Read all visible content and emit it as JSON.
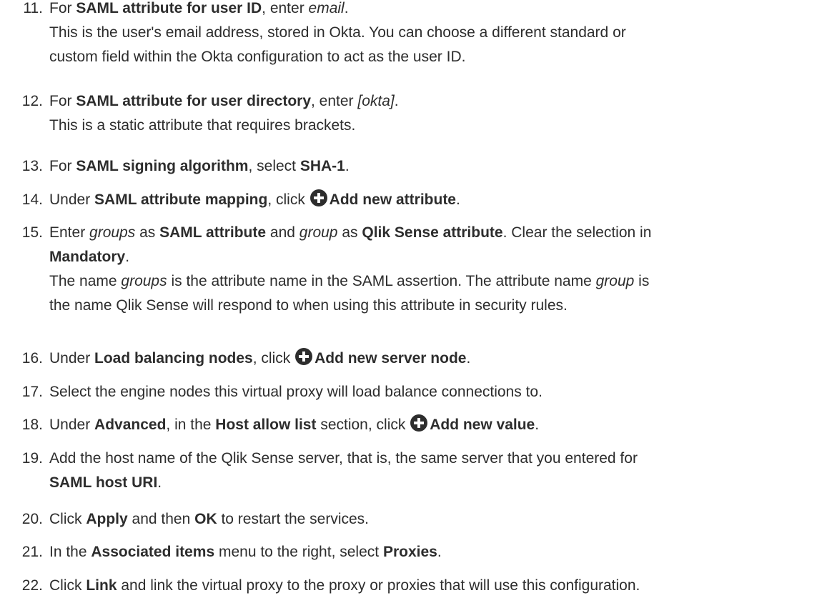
{
  "steps": [
    {
      "number": "11.",
      "lines": [
        [
          {
            "t": "For "
          },
          {
            "t": "SAML attribute for user ID",
            "b": true
          },
          {
            "t": ", enter "
          },
          {
            "t": "email",
            "i": true
          },
          {
            "t": "."
          }
        ],
        [
          {
            "t": "This is the user's email address, stored in Okta. You can choose a different standard or"
          }
        ],
        [
          {
            "t": "custom field within the Okta configuration to act as the user ID."
          }
        ]
      ]
    },
    {
      "number": "12.",
      "lines": [
        [
          {
            "t": "For "
          },
          {
            "t": "SAML attribute for user directory",
            "b": true
          },
          {
            "t": ", enter "
          },
          {
            "t": "[okta]",
            "i": true
          },
          {
            "t": "."
          }
        ],
        [
          {
            "t": "This is a static attribute that requires brackets."
          }
        ]
      ]
    },
    {
      "number": "13.",
      "lines": [
        [
          {
            "t": "For "
          },
          {
            "t": "SAML signing algorithm",
            "b": true
          },
          {
            "t": ", select "
          },
          {
            "t": "SHA-1",
            "b": true
          },
          {
            "t": "."
          }
        ]
      ]
    },
    {
      "number": "14.",
      "lines": [
        [
          {
            "t": "Under "
          },
          {
            "t": "SAML attribute mapping",
            "b": true
          },
          {
            "t": ", click "
          },
          {
            "icon": "plus-circle-icon"
          },
          {
            "t": "Add new attribute",
            "b": true
          },
          {
            "t": "."
          }
        ]
      ]
    },
    {
      "number": "15.",
      "lines": [
        [
          {
            "t": "Enter "
          },
          {
            "t": "groups",
            "i": true
          },
          {
            "t": " as "
          },
          {
            "t": "SAML attribute",
            "b": true
          },
          {
            "t": " and "
          },
          {
            "t": "group",
            "i": true
          },
          {
            "t": " as "
          },
          {
            "t": "Qlik Sense attribute",
            "b": true
          },
          {
            "t": ". Clear the selection in"
          }
        ],
        [
          {
            "t": "Mandatory",
            "b": true
          },
          {
            "t": "."
          }
        ],
        [
          {
            "t": "The name "
          },
          {
            "t": "groups",
            "i": true
          },
          {
            "t": " is the attribute name in the SAML assertion. The attribute name "
          },
          {
            "t": "group",
            "i": true
          },
          {
            "t": " is"
          }
        ],
        [
          {
            "t": "the name Qlik Sense will respond to when using this attribute in security rules."
          }
        ]
      ]
    },
    {
      "number": "16.",
      "lines": [
        [
          {
            "t": "Under "
          },
          {
            "t": "Load balancing nodes",
            "b": true
          },
          {
            "t": ", click "
          },
          {
            "icon": "plus-circle-icon"
          },
          {
            "t": "Add new server node",
            "b": true
          },
          {
            "t": "."
          }
        ]
      ]
    },
    {
      "number": "17.",
      "lines": [
        [
          {
            "t": "Select the engine nodes this virtual proxy will load balance connections to."
          }
        ]
      ]
    },
    {
      "number": "18.",
      "lines": [
        [
          {
            "t": "Under "
          },
          {
            "t": "Advanced",
            "b": true
          },
          {
            "t": ", in the "
          },
          {
            "t": "Host allow list",
            "b": true
          },
          {
            "t": " section, click "
          },
          {
            "icon": "plus-circle-icon"
          },
          {
            "t": "Add new value",
            "b": true
          },
          {
            "t": "."
          }
        ]
      ]
    },
    {
      "number": "19.",
      "lines": [
        [
          {
            "t": "Add the host name of the Qlik Sense server, that is, the same server that you entered for"
          }
        ],
        [
          {
            "t": "SAML host URI",
            "b": true
          },
          {
            "t": "."
          }
        ]
      ]
    },
    {
      "number": "20.",
      "lines": [
        [
          {
            "t": "Click "
          },
          {
            "t": "Apply",
            "b": true
          },
          {
            "t": " and then "
          },
          {
            "t": "OK",
            "b": true
          },
          {
            "t": " to restart the services."
          }
        ]
      ]
    },
    {
      "number": "21.",
      "lines": [
        [
          {
            "t": "In the "
          },
          {
            "t": "Associated items",
            "b": true
          },
          {
            "t": " menu to the right, select "
          },
          {
            "t": "Proxies",
            "b": true
          },
          {
            "t": "."
          }
        ]
      ]
    },
    {
      "number": "22.",
      "lines": [
        [
          {
            "t": "Click "
          },
          {
            "t": "Link",
            "b": true
          },
          {
            "t": " and link the virtual proxy to the proxy or proxies that will use this configuration."
          }
        ]
      ]
    }
  ]
}
